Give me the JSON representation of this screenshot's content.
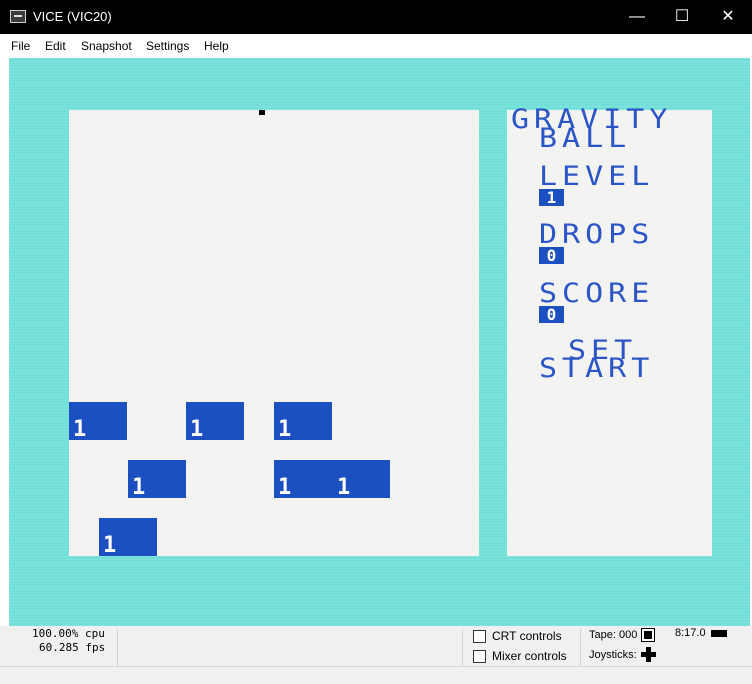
{
  "window": {
    "title": "VICE (VIC20)",
    "controls": {
      "minimize": "—",
      "maximize": "☐",
      "close": "✕"
    }
  },
  "menu": [
    "File",
    "Edit",
    "Snapshot",
    "Settings",
    "Help"
  ],
  "game": {
    "title_line1": "GRAVITY",
    "title_line2": "BALL",
    "level_label": "LEVEL",
    "level_value": "1",
    "drops_label": "DROPS",
    "drops_value": "0",
    "score_label": "SCORE",
    "score_value": "0",
    "set_label": "SET",
    "start_label": "START",
    "blocks": [
      "1",
      "1",
      "1",
      "1",
      "1",
      "1",
      "1"
    ],
    "colors": {
      "border": "#72e0d8",
      "field": "#f3f3f1",
      "block": "#1c4fc0",
      "text": "#2b55c7"
    }
  },
  "status": {
    "cpu": "100.00% cpu",
    "fps": "60.285 fps",
    "crt_controls": "CRT controls",
    "mixer_controls": "Mixer controls",
    "tape_label": "Tape: 000",
    "drive_status": "8:17.0",
    "joysticks_label": "Joysticks:"
  }
}
